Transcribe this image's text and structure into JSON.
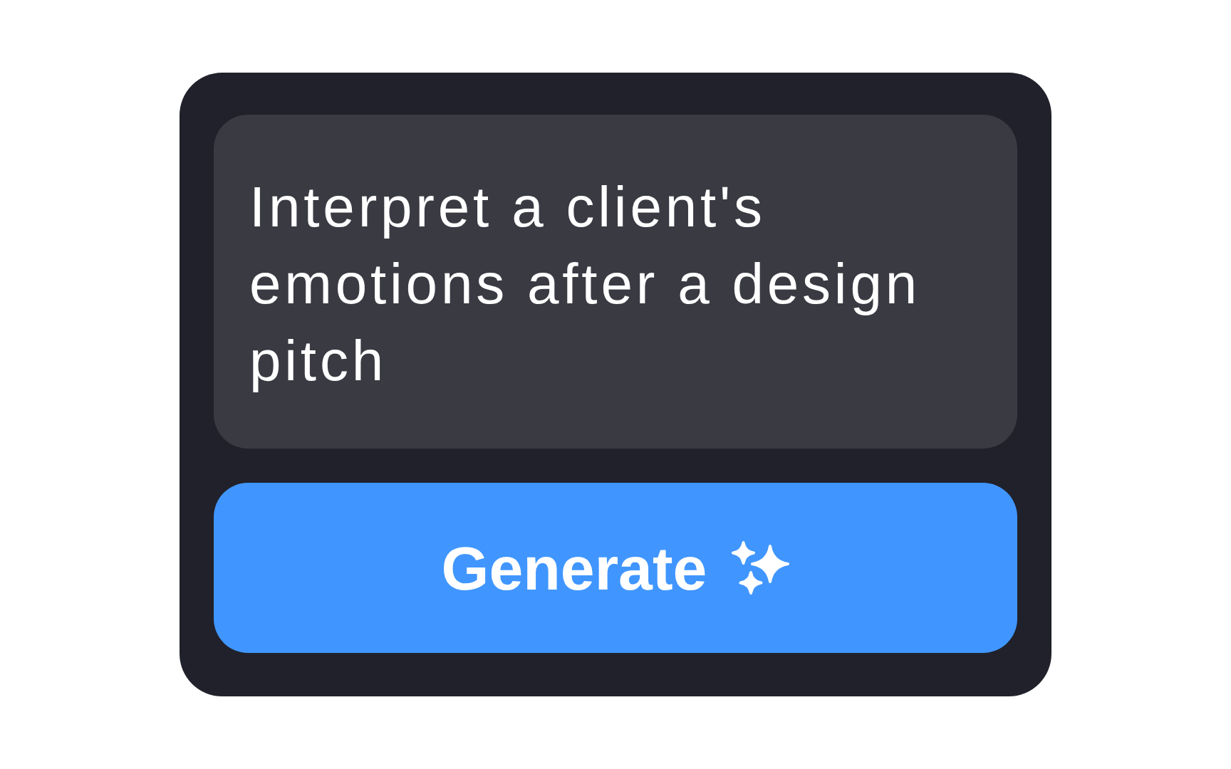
{
  "prompt_field": {
    "value": "Interpret a client's emotions after a design pitch"
  },
  "generate_button": {
    "label": "Generate"
  }
}
